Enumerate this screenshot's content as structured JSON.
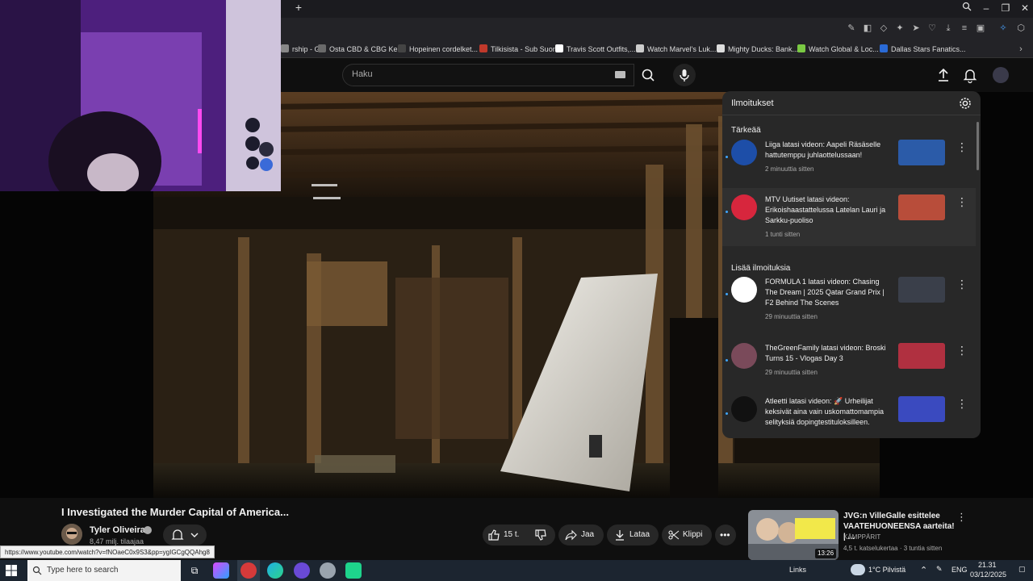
{
  "bookmarks": [
    {
      "label": "rship - G...",
      "color": "#888888"
    },
    {
      "label": "Osta CBD & CBG Ke...",
      "color": "#6a6a6a"
    },
    {
      "label": "Hopeinen cordelket...",
      "color": "#444444"
    },
    {
      "label": "Tilkisista - Sub Suora",
      "color": "#c0392b"
    },
    {
      "label": "Travis Scott Outfits,...",
      "color": "#ffffff"
    },
    {
      "label": "Watch Marvel's Luk...",
      "color": "#cccccc"
    },
    {
      "label": "Mighty Ducks: Bank...",
      "color": "#dddddd"
    },
    {
      "label": "Watch Global & Loc...",
      "color": "#7ac943"
    },
    {
      "label": "Dallas Stars Fanatics...",
      "color": "#2a6ad6"
    }
  ],
  "search": {
    "placeholder": "Haku"
  },
  "notifications": {
    "title": "Ilmoitukset",
    "important_label": "Tärkeää",
    "more_label": "Lisää ilmoituksia",
    "important": [
      {
        "text": "Liiga latasi videon: Aapeli Räsäselle hattutemppu juhlaottelussaan!",
        "time": "2 minuuttia sitten",
        "avatar_color": "#1d4ea8",
        "thumb_color": "#2b5ba8"
      },
      {
        "text": "MTV Uutiset latasi videon: Erikoishaastattelussa Latelan Lauri ja Sarkku-puoliso",
        "time": "1 tunti sitten",
        "avatar_color": "#d7263d",
        "thumb_color": "#b84d3a"
      }
    ],
    "more": [
      {
        "text": "FORMULA 1 latasi videon: Chasing The Dream | 2025 Qatar Grand Prix | F2 Behind The Scenes",
        "time": "29 minuuttia sitten",
        "avatar_color": "#ffffff",
        "thumb_color": "#3a3f4a"
      },
      {
        "text": "TheGreenFamily latasi videon: Broski Turns 15 - Vlogas Day 3",
        "time": "29 minuuttia sitten",
        "avatar_color": "#7a4a5a",
        "thumb_color": "#b03040"
      },
      {
        "text": "Atleetti latasi videon: 🚀 Urheilijat keksivät aina vain uskomattomampia selityksiä dopingtestituloksilleen.",
        "time": "",
        "avatar_color": "#111111",
        "thumb_color": "#3a4abf"
      }
    ]
  },
  "video": {
    "title": "I Investigated the Murder Capital of America...",
    "channel": "Tyler Oliveira",
    "subscribers": "8,47 milj. tilaajaa",
    "likes": "15 t.",
    "share_label": "Jaa",
    "download_label": "Lataa",
    "clip_label": "Klippi"
  },
  "status_url": "https://www.youtube.com/watch?v=fNOaeC0x9S3&pp=ygIGCgQQAhg8",
  "recommended": {
    "title": "JVG:n VilleGalle esittelee VAATEHUONEENSA aarteita! | ...",
    "channel": "KÄMPPÄRIT",
    "meta": "4,5 t. katselukertaa · 3 tuntia sitten",
    "duration": "13:26"
  },
  "taskbar": {
    "search_placeholder": "Type here to search",
    "links_label": "Links",
    "weather": "1°C  Pilvistä",
    "language": "ENG",
    "time": "21.31",
    "date": "03/12/2025"
  }
}
